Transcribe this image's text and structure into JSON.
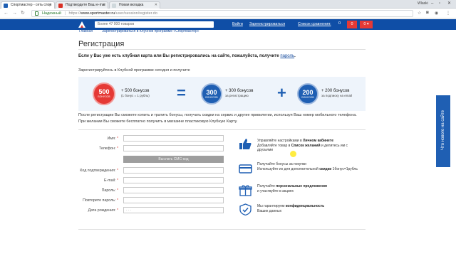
{
  "browser": {
    "tabs": [
      {
        "title": "Спортмастер - сеть спор",
        "active": true,
        "favicon_color": "#1f5fb3"
      },
      {
        "title": "Подтвердите Ваш e-mai",
        "active": false,
        "favicon_color": "#d93025"
      },
      {
        "title": "Новая вкладка",
        "active": false,
        "favicon_color": "#cfd8dc"
      }
    ],
    "window_user": "Wlaski",
    "security_label": "Надежный",
    "url_scheme": "https://",
    "url_host": "www.sportmaster.ru",
    "url_path": "/user/session/register.do"
  },
  "header": {
    "search_placeholder": "Более 47 000 товаров",
    "login": "Войти",
    "register": "Зарегистрироваться",
    "compare": "Список сравнения:",
    "compare_count": "0",
    "cart_count": "0",
    "account_count": "0"
  },
  "breadcrumbs": [
    "Главная",
    "Зарегистрироваться в Клубной программе «Спортмастер»"
  ],
  "page": {
    "title": "Регистрация",
    "intro_prefix": "Если у Вас уже есть клубная карта или Вы регистрировались на сайте, пожалуйста, получите ",
    "intro_link": "пароль",
    "intro_suffix": ".",
    "invite": "Зарегистрируйтесь в Клубной программе сегодня и получите"
  },
  "promo": {
    "coin1_value": "500",
    "coin1_sub": "БОНУСОВ",
    "item1_title": "+ 500 бонусов",
    "item1_sub": "(1 бонус = 1 рубль)",
    "coin2_value": "300",
    "coin2_sub": "БОНУСОВ",
    "item2_title": "+ 300 бонусов",
    "item2_sub": "за регистрацию",
    "coin3_value": "200",
    "coin3_sub": "БОНУСОВ",
    "item3_title": "+ 200 бонусов",
    "item3_sub": "за подписку на email",
    "equals": "=",
    "plus": "+"
  },
  "description": "После регистрации Вы сможете копить и тратить бонусы, получать скидки на сервис и другие привилегии, используя Ваш номер мобильного телефона. При желании Вы сможете бесплатно получить в магазине пластиковую Клубную Карту.",
  "form": {
    "name_label": "Имя:",
    "phone_label": "Телефон:",
    "sms_button": "Выслать СМС-код",
    "code_label": "Код подтверждения:",
    "email_label": "E-mail:",
    "password_label": "Пароль:",
    "password_repeat_label": "Повторите пароль:",
    "birthdate_label": "Дата рождения:",
    "birthdate_placeholder": ". . ."
  },
  "benefits": [
    {
      "line1_pre": "Управляйте настройками в ",
      "line1_bold": "Личном кабинете",
      "line2_pre": "Добавляйте товар в ",
      "line2_bold": "Список желаний",
      "line2_post": " и делитесь им с друзьями"
    },
    {
      "line1_pre": "Получайте бонусы за покупки",
      "line2_pre": "Используйте их для дополнительной ",
      "line2_bold": "скидки",
      "line2_post": " 1бонус=1рубль"
    },
    {
      "line1_pre": "Получайте ",
      "line1_bold": "персональные предложения",
      "line2_pre": "и участвуйте в акциях"
    },
    {
      "line1_pre": "Мы гарантируем ",
      "line1_bold": "конфиденциальность",
      "line2_pre": "Ваших данных"
    }
  ],
  "side_tab": "Что нового на сайте",
  "colors": {
    "brand_blue": "#0f4ea6",
    "accent_red": "#e53935",
    "promo_bg": "#eef4fb"
  }
}
